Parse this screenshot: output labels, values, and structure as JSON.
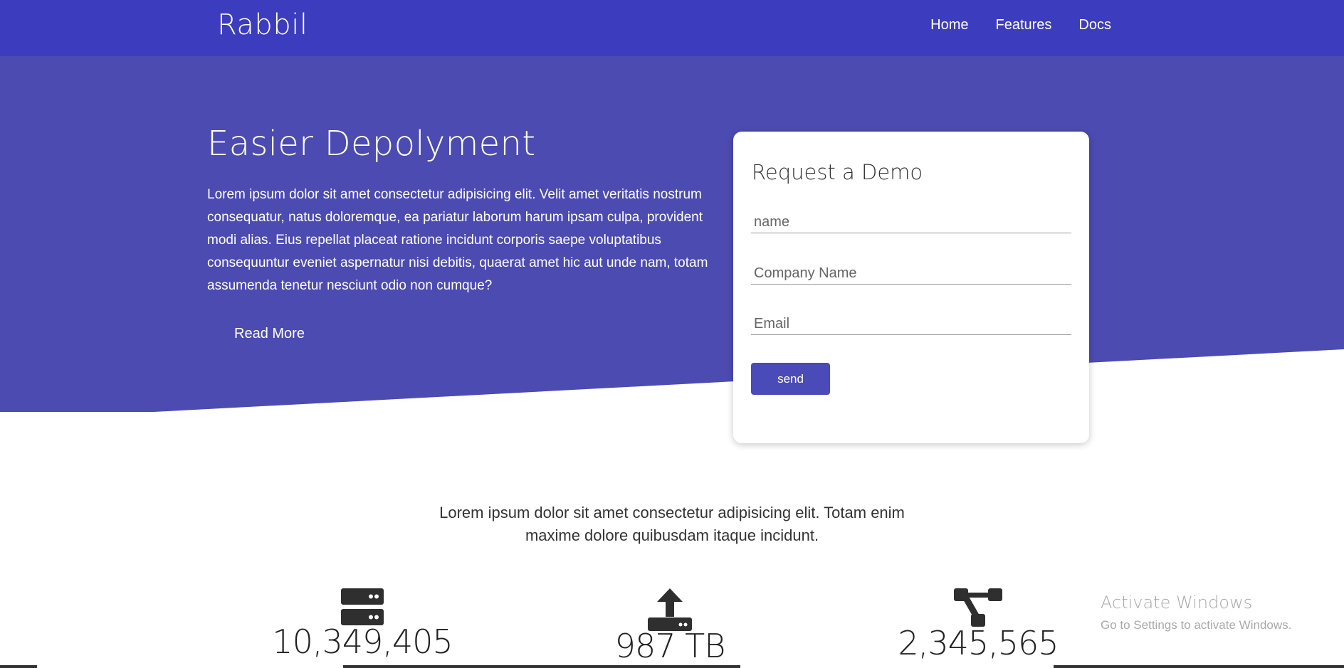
{
  "navbar": {
    "brand": "Rabbil",
    "links": [
      "Home",
      "Features",
      "Docs"
    ],
    "color": "#3c3cbe"
  },
  "hero": {
    "title": "Easier Depolyment",
    "text": "Lorem ipsum dolor sit amet consectetur adipisicing elit. Velit amet veritatis nostrum consequatur, natus doloremque, ea pariatur laborum harum ipsam culpa, provident modi alias. Eius repellat placeat ratione incidunt corporis saepe voluptatibus consequuntur eveniet aspernatur nisi debitis, quaerat amet hic aut unde nam, totam assumenda tenetur nesciunt odio non cumque?",
    "read_more": "Read More",
    "color": "#4b4bb2"
  },
  "demo_form": {
    "title": "Request a Demo",
    "name_placeholder": "name",
    "company_placeholder": "Company Name",
    "email_placeholder": "Email",
    "send_label": "send"
  },
  "intro": {
    "text": "Lorem ipsum dolor sit amet consectetur adipisicing elit. Totam enim maxime dolore quibusdam itaque incidunt."
  },
  "stats": [
    {
      "icon": "server-icon",
      "value": "10,349,405"
    },
    {
      "icon": "upload-icon",
      "value": "987 TB"
    },
    {
      "icon": "sitemap-icon",
      "value": "2,345,565"
    }
  ],
  "watermark": {
    "title": "Activate Windows",
    "subtitle": "Go to Settings to activate Windows."
  }
}
